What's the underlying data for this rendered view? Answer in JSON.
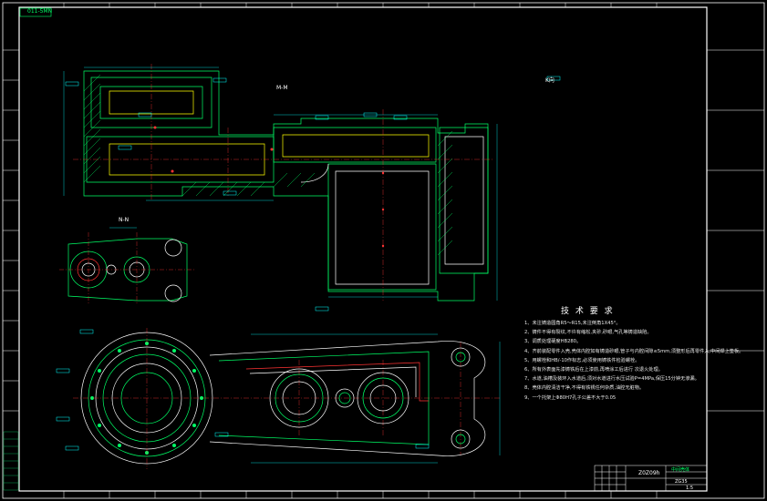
{
  "sheet": {
    "drawing_no_topleft": "011-5MN",
    "section_label_main": "M-M",
    "section_label_side": "N-N",
    "view_label_right": "K向"
  },
  "notes": {
    "title": "技 术 要 求",
    "items": [
      "1、未注铸造圆角R5～R15,未注倒角1X45°。",
      "2、铸件不得有裂纹,不许有缩松,夹砂,砂眼,气孔等铸造缺陷。",
      "3、调质处理硬度HB280。",
      "4、齐前装配零件入壳,壳体内腔如有铸造砂眼,管子与内腔间隙≤5mm,须整形后再零件入,中间焊上垫板。",
      "5、用螺栓和HB/-10作标志,必须使用铸铁件检验螺栓。",
      "6、所有外表面先漆铸铁后在上漆前,再喷涂工后进行    次退火处理。",
      "7、水道,油槽及装环入水道后,须对水道进行水压试验P=4MPa,保压15分钟无渗漏。",
      "8、壳体内腔清洁干净,不得有铁锈任何杂质,油腔无脏物。",
      "9、一个托架上Φ80H7孔子公差不大于0.05"
    ]
  },
  "title_block": {
    "drawing_code": "Z0Z09h",
    "part_name": "中间壳体",
    "material": "ZG35",
    "scale": "1:5"
  }
}
